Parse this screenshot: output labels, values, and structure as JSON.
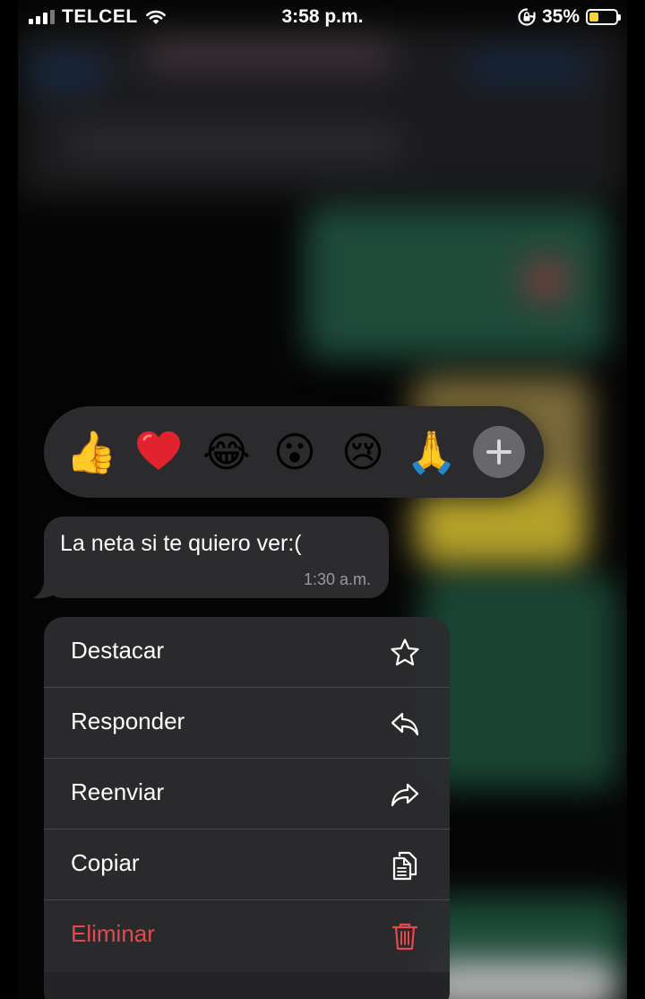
{
  "status_bar": {
    "carrier": "TELCEL",
    "time": "3:58 p.m.",
    "battery_percent": "35%",
    "battery_level": 0.35,
    "icons": [
      "signal-icon",
      "wifi-icon",
      "orientation-lock-icon",
      "battery-icon"
    ]
  },
  "reactions": {
    "items": [
      "👍",
      "❤️",
      "😂",
      "😮",
      "😢",
      "🙏"
    ],
    "more_icon": "plus-icon"
  },
  "message": {
    "text": "La neta si te quiero ver:(",
    "time": "1:30 a.m."
  },
  "menu": {
    "items": [
      {
        "label": "Destacar",
        "icon": "star-icon"
      },
      {
        "label": "Responder",
        "icon": "reply-icon"
      },
      {
        "label": "Reenviar",
        "icon": "forward-icon"
      },
      {
        "label": "Copiar",
        "icon": "copy-icon"
      },
      {
        "label": "Eliminar",
        "icon": "trash-icon"
      }
    ]
  },
  "colors": {
    "danger": "#e5494c",
    "menu_background": "#2c2c2e",
    "bubble_background": "#2c2c2e",
    "battery_fill": "#f6d33c"
  }
}
